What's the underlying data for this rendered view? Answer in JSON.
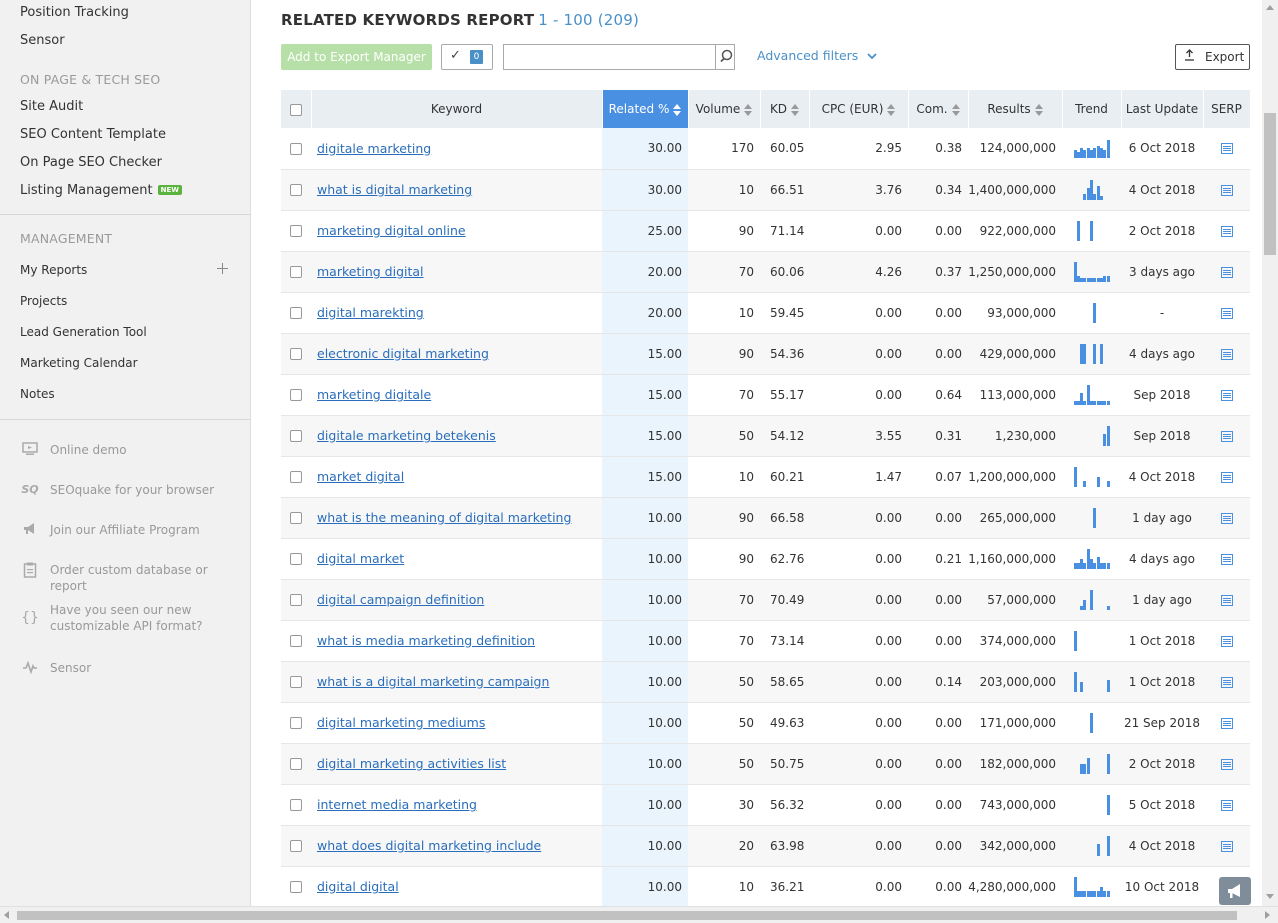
{
  "sidebar": {
    "top_items": [
      "Position Tracking",
      "Sensor"
    ],
    "on_page_heading": "ON PAGE & TECH SEO",
    "on_page_items": [
      "Site Audit",
      "SEO Content Template",
      "On Page SEO Checker",
      "Listing Management"
    ],
    "new_badge": "NEW",
    "management_heading": "MANAGEMENT",
    "management_items": [
      "My Reports",
      "Projects",
      "Lead Generation Tool",
      "Marketing Calendar",
      "Notes"
    ],
    "promos": [
      "Online demo",
      "SEOquake for your browser",
      "Join our Affiliate Program",
      "Order custom database or report",
      "Have you seen our new customizable API format?",
      "Sensor"
    ],
    "promo_icon_sq": "SQ",
    "promo_icon_braces": "{}"
  },
  "report": {
    "title": "RELATED KEYWORDS REPORT",
    "count": "1 - 100 (209)",
    "export_manager_label": "Add to Export Manager",
    "selected_count": "0",
    "search_value": "",
    "advanced_filters_label": "Advanced filters",
    "export_label": "Export"
  },
  "table": {
    "headers": [
      "Keyword",
      "Related %",
      "Volume",
      "KD",
      "CPC (EUR)",
      "Com.",
      "Results",
      "Trend",
      "Last Update",
      "SERP"
    ],
    "rows": [
      {
        "keyword": "digitale marketing",
        "related": "30.00",
        "volume": "170",
        "kd": "60.05",
        "cpc": "2.95",
        "com": "0.38",
        "results": "124,000,000",
        "last_update": "6 Oct 2018",
        "trend": [
          0.4,
          0.3,
          0.5,
          0.4,
          0.5,
          0.4,
          0.5,
          0.6,
          0.5,
          0.4,
          0.9
        ]
      },
      {
        "keyword": "what is digital marketing",
        "related": "30.00",
        "volume": "10",
        "kd": "66.51",
        "cpc": "3.76",
        "com": "0.34",
        "results": "1,400,000,000",
        "last_update": "4 Oct 2018",
        "trend": [
          0,
          0,
          0,
          0.3,
          0.6,
          1,
          0.3,
          0.7,
          0.2,
          0,
          0
        ]
      },
      {
        "keyword": "marketing digital online",
        "related": "25.00",
        "volume": "90",
        "kd": "71.14",
        "cpc": "0.00",
        "com": "0.00",
        "results": "922,000,000",
        "last_update": "2 Oct 2018",
        "trend": [
          0,
          1,
          0,
          0,
          0,
          1,
          0,
          0,
          0,
          0,
          0
        ]
      },
      {
        "keyword": "marketing digital",
        "related": "20.00",
        "volume": "70",
        "kd": "60.06",
        "cpc": "4.26",
        "com": "0.37",
        "results": "1,250,000,000",
        "last_update": "3 days ago",
        "trend": [
          1,
          0.3,
          0.2,
          0.2,
          0.2,
          0.2,
          0.2,
          0.2,
          0.2,
          0.3,
          0.3
        ]
      },
      {
        "keyword": "digital marekting",
        "related": "20.00",
        "volume": "10",
        "kd": "59.45",
        "cpc": "0.00",
        "com": "0.00",
        "results": "93,000,000",
        "last_update": "-",
        "trend": [
          0,
          0,
          0,
          0,
          0,
          0,
          1,
          0,
          0,
          0,
          0
        ]
      },
      {
        "keyword": "electronic digital marketing",
        "related": "15.00",
        "volume": "90",
        "kd": "54.36",
        "cpc": "0.00",
        "com": "0.00",
        "results": "429,000,000",
        "last_update": "4 days ago",
        "trend": [
          0,
          0,
          1,
          1,
          0,
          0,
          1,
          0,
          1,
          0,
          0
        ]
      },
      {
        "keyword": "marketing digitale",
        "related": "15.00",
        "volume": "70",
        "kd": "55.17",
        "cpc": "0.00",
        "com": "0.64",
        "results": "113,000,000",
        "last_update": "Sep 2018",
        "trend": [
          0.2,
          0.2,
          0.6,
          0.2,
          1,
          0.2,
          0.2,
          0.2,
          0.2,
          0.2,
          0.2
        ]
      },
      {
        "keyword": "digitale marketing betekenis",
        "related": "15.00",
        "volume": "50",
        "kd": "54.12",
        "cpc": "3.55",
        "com": "0.31",
        "results": "1,230,000",
        "last_update": "Sep 2018",
        "trend": [
          0,
          0,
          0,
          0,
          0,
          0,
          0,
          0,
          0,
          0.6,
          1
        ]
      },
      {
        "keyword": "market digital",
        "related": "15.00",
        "volume": "10",
        "kd": "60.21",
        "cpc": "1.47",
        "com": "0.07",
        "results": "1,200,000,000",
        "last_update": "4 Oct 2018",
        "trend": [
          1,
          0,
          0,
          0.3,
          0,
          0,
          0,
          0.5,
          0,
          0,
          0.3
        ]
      },
      {
        "keyword": "what is the meaning of digital marketing",
        "related": "10.00",
        "volume": "90",
        "kd": "66.58",
        "cpc": "0.00",
        "com": "0.00",
        "results": "265,000,000",
        "last_update": "1 day ago",
        "trend": [
          0,
          0,
          0,
          0,
          0,
          0,
          1,
          0,
          0,
          0,
          0
        ]
      },
      {
        "keyword": "digital market",
        "related": "10.00",
        "volume": "90",
        "kd": "62.76",
        "cpc": "0.00",
        "com": "0.21",
        "results": "1,160,000,000",
        "last_update": "4 days ago",
        "trend": [
          0.3,
          0.3,
          0.5,
          0.3,
          1,
          0.5,
          0.3,
          0.6,
          0.3,
          0.3,
          0.3
        ]
      },
      {
        "keyword": "digital campaign definition",
        "related": "10.00",
        "volume": "70",
        "kd": "70.49",
        "cpc": "0.00",
        "com": "0.00",
        "results": "57,000,000",
        "last_update": "1 day ago",
        "trend": [
          0,
          0,
          0.2,
          0.5,
          0,
          1,
          0,
          0,
          0,
          0,
          0.2
        ]
      },
      {
        "keyword": "what is media marketing definition",
        "related": "10.00",
        "volume": "70",
        "kd": "73.14",
        "cpc": "0.00",
        "com": "0.00",
        "results": "374,000,000",
        "last_update": "1 Oct 2018",
        "trend": [
          1,
          0,
          0,
          0,
          0,
          0,
          0,
          0,
          0,
          0,
          0
        ]
      },
      {
        "keyword": "what is a digital marketing campaign",
        "related": "10.00",
        "volume": "50",
        "kd": "58.65",
        "cpc": "0.00",
        "com": "0.14",
        "results": "203,000,000",
        "last_update": "1 Oct 2018",
        "trend": [
          1,
          0,
          0.5,
          0,
          0,
          0,
          0,
          0,
          0,
          0,
          0.6
        ]
      },
      {
        "keyword": "digital marketing mediums",
        "related": "10.00",
        "volume": "50",
        "kd": "49.63",
        "cpc": "0.00",
        "com": "0.00",
        "results": "171,000,000",
        "last_update": "21 Sep 2018",
        "trend": [
          0,
          0,
          0,
          0,
          0,
          1,
          0,
          0,
          0,
          0,
          0
        ]
      },
      {
        "keyword": "digital marketing activities list",
        "related": "10.00",
        "volume": "50",
        "kd": "50.75",
        "cpc": "0.00",
        "com": "0.00",
        "results": "182,000,000",
        "last_update": "2 Oct 2018",
        "trend": [
          0,
          0,
          0.5,
          0.5,
          0.8,
          0,
          0,
          0,
          0,
          0,
          1
        ]
      },
      {
        "keyword": "internet media marketing",
        "related": "10.00",
        "volume": "30",
        "kd": "56.32",
        "cpc": "0.00",
        "com": "0.00",
        "results": "743,000,000",
        "last_update": "5 Oct 2018",
        "trend": [
          0,
          0,
          0,
          0,
          0,
          0,
          0,
          0,
          0,
          0,
          1
        ]
      },
      {
        "keyword": "what does digital marketing include",
        "related": "10.00",
        "volume": "20",
        "kd": "63.98",
        "cpc": "0.00",
        "com": "0.00",
        "results": "342,000,000",
        "last_update": "4 Oct 2018",
        "trend": [
          0,
          0,
          0,
          0,
          0,
          0,
          0,
          0.6,
          0,
          0,
          1
        ]
      },
      {
        "keyword": "digital digital",
        "related": "10.00",
        "volume": "10",
        "kd": "36.21",
        "cpc": "0.00",
        "com": "0.00",
        "results": "4,280,000,000",
        "last_update": "10 Oct 2018",
        "trend": [
          1,
          0.3,
          0.3,
          0.3,
          0.3,
          0.3,
          0.3,
          0.3,
          0.5,
          0.3,
          0.3
        ]
      }
    ]
  },
  "colors": {
    "accent": "#4a90e2",
    "link": "#2a6ebb",
    "button_green": "#b7e0a8",
    "new_badge": "#59b33c"
  }
}
